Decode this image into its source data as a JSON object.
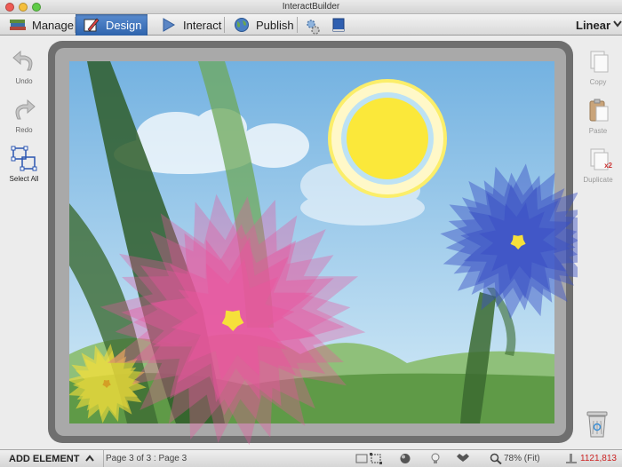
{
  "window": {
    "title": "InteractBuilder"
  },
  "toolbar": {
    "tabs": [
      {
        "label": "Manage",
        "icon": "books-icon"
      },
      {
        "label": "Design",
        "icon": "pencil-icon",
        "active": true
      },
      {
        "label": "Interact",
        "icon": "play-icon"
      },
      {
        "label": "Publish",
        "icon": "globe-icon"
      }
    ],
    "extra_icons": [
      "gear-icon",
      "book-icon"
    ],
    "mode_label": "Linear"
  },
  "left_panel": {
    "undo_label": "Undo",
    "redo_label": "Redo",
    "select_all_label": "Select All"
  },
  "right_panel": {
    "copy_label": "Copy",
    "paste_label": "Paste",
    "duplicate_label": "Duplicate",
    "duplicate_badge": "x2",
    "trash_icon": "trash-icon"
  },
  "status_bar": {
    "add_element_label": "ADD ELEMENT",
    "page_status": "Page 3 of 3 : Page 3",
    "zoom": "78% (Fit)",
    "coords": "1121,813"
  },
  "colors": {
    "sky_top": "#7ab6e2",
    "sky_bottom": "#cfe7f6",
    "pink_flower": "#e9559d",
    "blue_flower": "#3a4fc4",
    "yellow_flower": "#f6e03a",
    "sun": "#fbe83a",
    "stem": "#2f5d2a",
    "active_tab": "#3b6fb8",
    "coords_red": "#cc2222"
  }
}
